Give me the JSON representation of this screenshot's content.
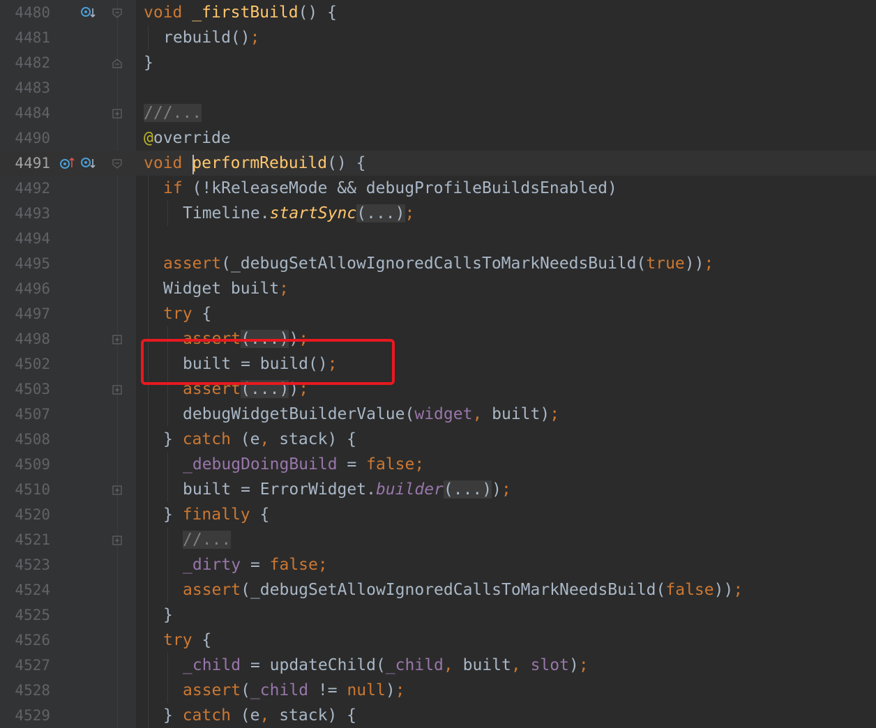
{
  "editor": {
    "language": "Dart",
    "current_line": "4491",
    "lines": [
      {
        "num": "4480"
      },
      {
        "num": "4481"
      },
      {
        "num": "4482"
      },
      {
        "num": "4483"
      },
      {
        "num": "4484"
      },
      {
        "num": "4490"
      },
      {
        "num": "4491"
      },
      {
        "num": "4492"
      },
      {
        "num": "4493"
      },
      {
        "num": "4494"
      },
      {
        "num": "4495"
      },
      {
        "num": "4496"
      },
      {
        "num": "4497"
      },
      {
        "num": "4498"
      },
      {
        "num": "4502"
      },
      {
        "num": "4503"
      },
      {
        "num": "4507"
      },
      {
        "num": "4508"
      },
      {
        "num": "4509"
      },
      {
        "num": "4510"
      },
      {
        "num": "4520"
      },
      {
        "num": "4521"
      },
      {
        "num": "4523"
      },
      {
        "num": "4524"
      },
      {
        "num": "4525"
      },
      {
        "num": "4526"
      },
      {
        "num": "4527"
      },
      {
        "num": "4528"
      },
      {
        "num": "4529"
      }
    ],
    "code": {
      "l4480": {
        "kw": "void",
        "fn": "_firstBuild",
        "rest": "() {"
      },
      "l4481": {
        "text": "rebuild()",
        "semi": ";"
      },
      "l4482": {
        "text": "}"
      },
      "l4484": {
        "fold": "///..."
      },
      "l4490": {
        "at": "@",
        "ann": "override"
      },
      "l4491": {
        "kw": "void",
        "fn": "performRebuild",
        "rest": "() {"
      },
      "l4492": {
        "kw": "if",
        "rest": " (!kReleaseMode && debugProfileBuildsEnabled)"
      },
      "l4493": {
        "cls": "Timeline.",
        "method": "startSync",
        "fold": "(...)",
        "semi": ";"
      },
      "l4495": {
        "kw": "assert",
        "open": "(_debugSetAllowIgnoredCallsToMarkNeedsBuild(",
        "lit": "true",
        "close": "))",
        "semi": ";"
      },
      "l4496": {
        "text": "Widget built",
        "semi": ";"
      },
      "l4497": {
        "kw": "try",
        "rest": " {"
      },
      "l4498": {
        "kw": "assert",
        "fold": "(...)",
        "close": ")",
        "semi": ";"
      },
      "l4502": {
        "text": "built = build()",
        "semi": ";"
      },
      "l4503": {
        "kw": "assert",
        "fold": "(...)",
        "close": ")",
        "semi": ";"
      },
      "l4507": {
        "pre": "debugWidgetBuilderValue(",
        "fld": "widget",
        "comma": ",",
        "post": " built)",
        "semi": ";"
      },
      "l4508": {
        "pre": "} ",
        "kw": "catch",
        "rest": " (e",
        "comma": ",",
        "post": " stack) {"
      },
      "l4509": {
        "fld": "_debugDoingBuild",
        "mid": " = ",
        "lit": "false",
        "semi": ";"
      },
      "l4510": {
        "pre": "built = ErrorWidget.",
        "method": "builder",
        "fold": "(...)",
        "close": ")",
        "semi": ";"
      },
      "l4520": {
        "pre": "} ",
        "kw": "finally",
        "rest": " {"
      },
      "l4521": {
        "fold": "//..."
      },
      "l4523": {
        "fld": "_dirty",
        "mid": " = ",
        "lit": "false",
        "semi": ";"
      },
      "l4524": {
        "kw": "assert",
        "open": "(_debugSetAllowIgnoredCallsToMarkNeedsBuild(",
        "lit": "false",
        "close": "))",
        "semi": ";"
      },
      "l4525": {
        "text": "}"
      },
      "l4526": {
        "kw": "try",
        "rest": " {"
      },
      "l4527": {
        "fld": "_child",
        "mid": " = updateChild(",
        "fld2": "_child",
        "comma": ",",
        "mid2": " built",
        "comma2": ",",
        "fld3": " slot",
        "close": ")",
        "semi": ";"
      },
      "l4528": {
        "kw": "assert",
        "open": "(",
        "fld": "_child",
        "mid": " != ",
        "lit": "null",
        "close": ")",
        "semi": ";"
      },
      "l4529": {
        "pre": "} ",
        "kw": "catch",
        "rest": " (e",
        "comma": ",",
        "post": " stack) {"
      }
    },
    "gutter_icons": {
      "implements_icon": "circle-arrow-down-icon",
      "overrides_icon": "circle-arrow-up-icon"
    },
    "colors": {
      "background": "#2b2b2b",
      "keyword": "#cc7832",
      "function": "#ffc66d",
      "field": "#9876aa",
      "highlight_box": "#e8191f"
    }
  }
}
